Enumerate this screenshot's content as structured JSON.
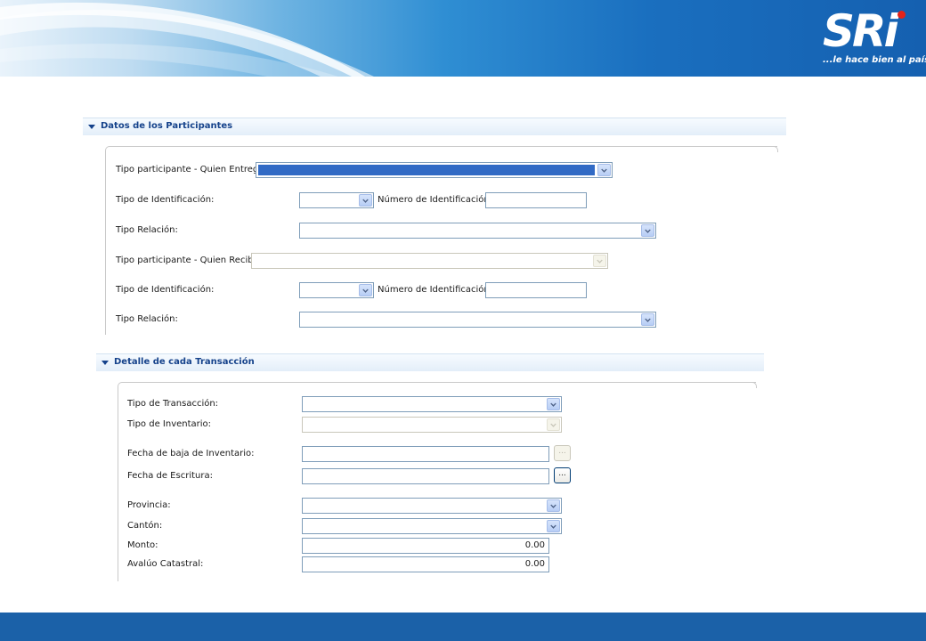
{
  "brand": {
    "logo_text": "SRi",
    "tagline": "...le hace bien al país!",
    "accent_color": "#e2231a",
    "footer_color": "#1b61a8"
  },
  "participants": {
    "title": "Datos de los Participantes",
    "entrega_tipo_label": "Tipo participante - Quien Entrega:",
    "entrega_tipo_id_label": "Tipo de Identificación:",
    "entrega_num_id_label": "Número de Identificación:",
    "entrega_relacion_label": "Tipo Relación:",
    "recibe_tipo_label": "Tipo participante - Quien Recibe:",
    "recibe_tipo_id_label": "Tipo de Identificación:",
    "recibe_num_id_label": "Número de Identificación:",
    "recibe_relacion_label": "Tipo Relación:"
  },
  "transaction": {
    "title": "Detalle de cada Transacción",
    "tipo_transaccion_label": "Tipo de Transacción:",
    "tipo_inventario_label": "Tipo de Inventario:",
    "fecha_baja_label": "Fecha de baja de Inventario:",
    "fecha_escritura_label": "Fecha de Escritura:",
    "provincia_label": "Provincia:",
    "canton_label": "Cantón:",
    "monto_label": "Monto:",
    "monto_value": "0.00",
    "avaluo_label": "Avalúo Catastral:",
    "avaluo_value": "0.00",
    "picker_label": "..."
  },
  "icons": {
    "collapse": "triangle-down-icon",
    "dropdown": "chevron-down-icon"
  }
}
